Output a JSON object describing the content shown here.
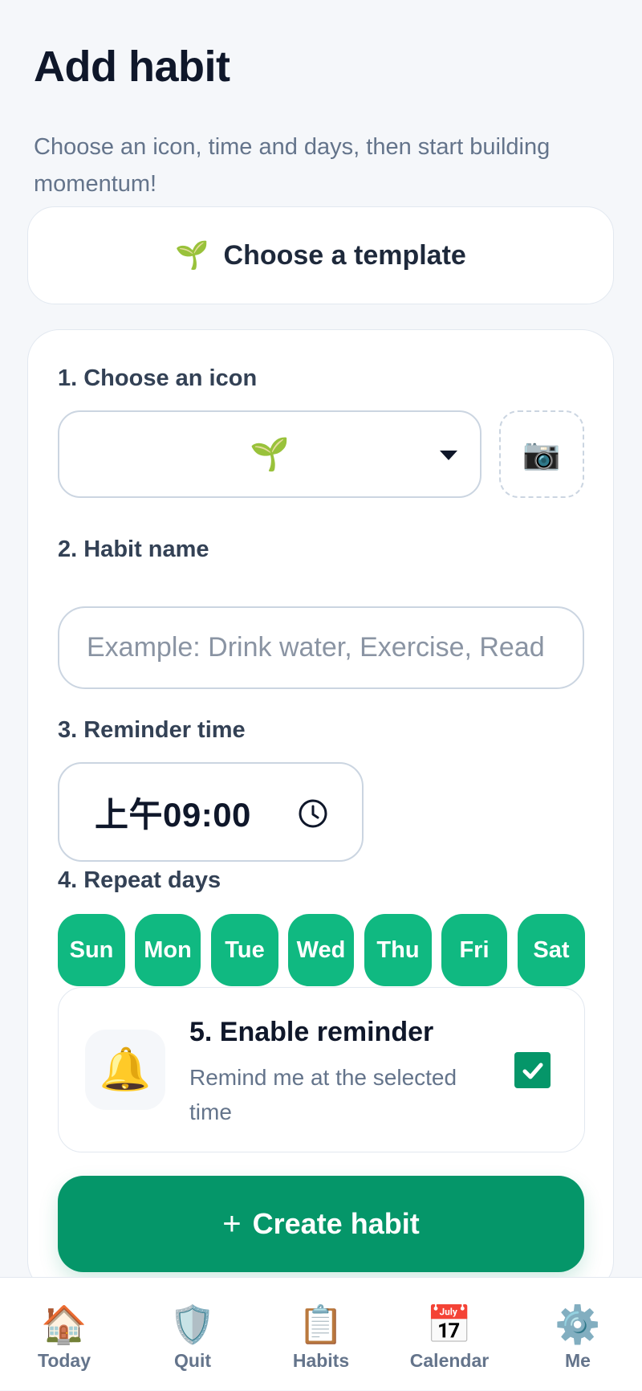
{
  "page": {
    "title": "Add habit",
    "subtitle": "Choose an icon, time and days, then start building momentum!"
  },
  "template": {
    "icon": "🌱",
    "label": "Choose a template"
  },
  "form": {
    "icon_section": {
      "label": "1. Choose an icon",
      "selected_icon": "🌱",
      "photo_icon": "📷"
    },
    "name_section": {
      "label": "2. Habit name",
      "value": "",
      "placeholder": "Example: Drink water, Exercise, Read"
    },
    "time_section": {
      "label": "3. Reminder time",
      "value": "上午09:00"
    },
    "days_section": {
      "label": "4. Repeat days",
      "days": [
        {
          "label": "Sun",
          "selected": true
        },
        {
          "label": "Mon",
          "selected": true
        },
        {
          "label": "Tue",
          "selected": true
        },
        {
          "label": "Wed",
          "selected": true
        },
        {
          "label": "Thu",
          "selected": true
        },
        {
          "label": "Fri",
          "selected": true
        },
        {
          "label": "Sat",
          "selected": true
        }
      ]
    },
    "reminder": {
      "icon": "🔔",
      "title": "5. Enable reminder",
      "description": "Remind me at the selected time",
      "enabled": true
    },
    "submit": {
      "plus": "+",
      "label": "Create habit"
    }
  },
  "nav": {
    "items": [
      {
        "icon": "🏠",
        "label": "Today"
      },
      {
        "icon": "🛡️",
        "label": "Quit"
      },
      {
        "icon": "📋",
        "label": "Habits"
      },
      {
        "icon": "📅",
        "label": "Calendar"
      },
      {
        "icon": "⚙️",
        "label": "Me"
      }
    ]
  },
  "colors": {
    "accent": "#10b981",
    "primary_button": "#059669",
    "background": "#f5f7fa",
    "muted_text": "#64748b"
  }
}
